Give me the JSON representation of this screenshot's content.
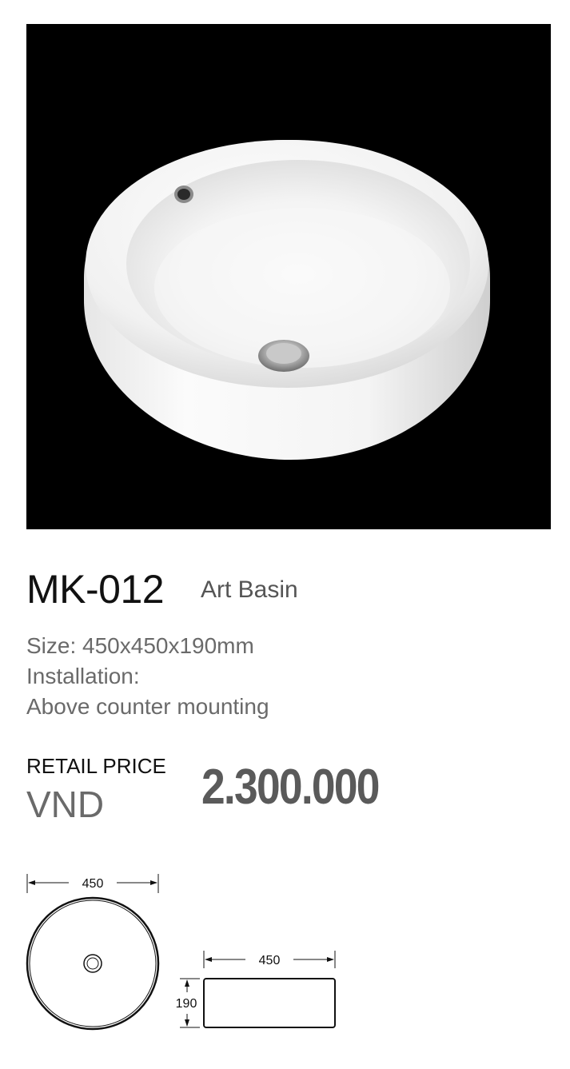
{
  "product": {
    "model": "MK-012",
    "name": "Art Basin"
  },
  "specs": {
    "size": "Size: 450x450x190mm",
    "installation": "Installation:",
    "mounting": "Above counter mounting"
  },
  "price": {
    "label": "RETAIL PRICE",
    "currency": "VND",
    "value": "2.300.000"
  },
  "dimensions": {
    "top_view_width": "450",
    "side_view_width": "450",
    "side_view_height": "190"
  }
}
